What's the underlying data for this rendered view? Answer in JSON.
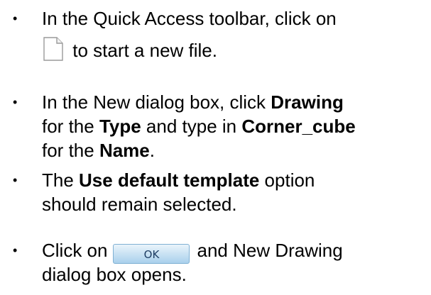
{
  "bullet_glyph": "•",
  "steps": [
    {
      "part1": "In the Quick Access toolbar, click on",
      "icon": "new-file-icon",
      "part2": " to start a new file."
    },
    {
      "part1": "In the New dialog box, click ",
      "bold1": "Drawing",
      "part2": "for the ",
      "bold2": "Type",
      "part3": " and type in ",
      "bold3": "Corner_cube",
      "part4": "for the ",
      "bold4": "Name",
      "part5": "."
    },
    {
      "part1": "The ",
      "bold1": "Use default template",
      "part2": " option",
      "part3": "should remain selected."
    },
    {
      "part1": "Click on",
      "button_label": "OK",
      "part2": "and New Drawing",
      "part3": "dialog box opens."
    }
  ]
}
